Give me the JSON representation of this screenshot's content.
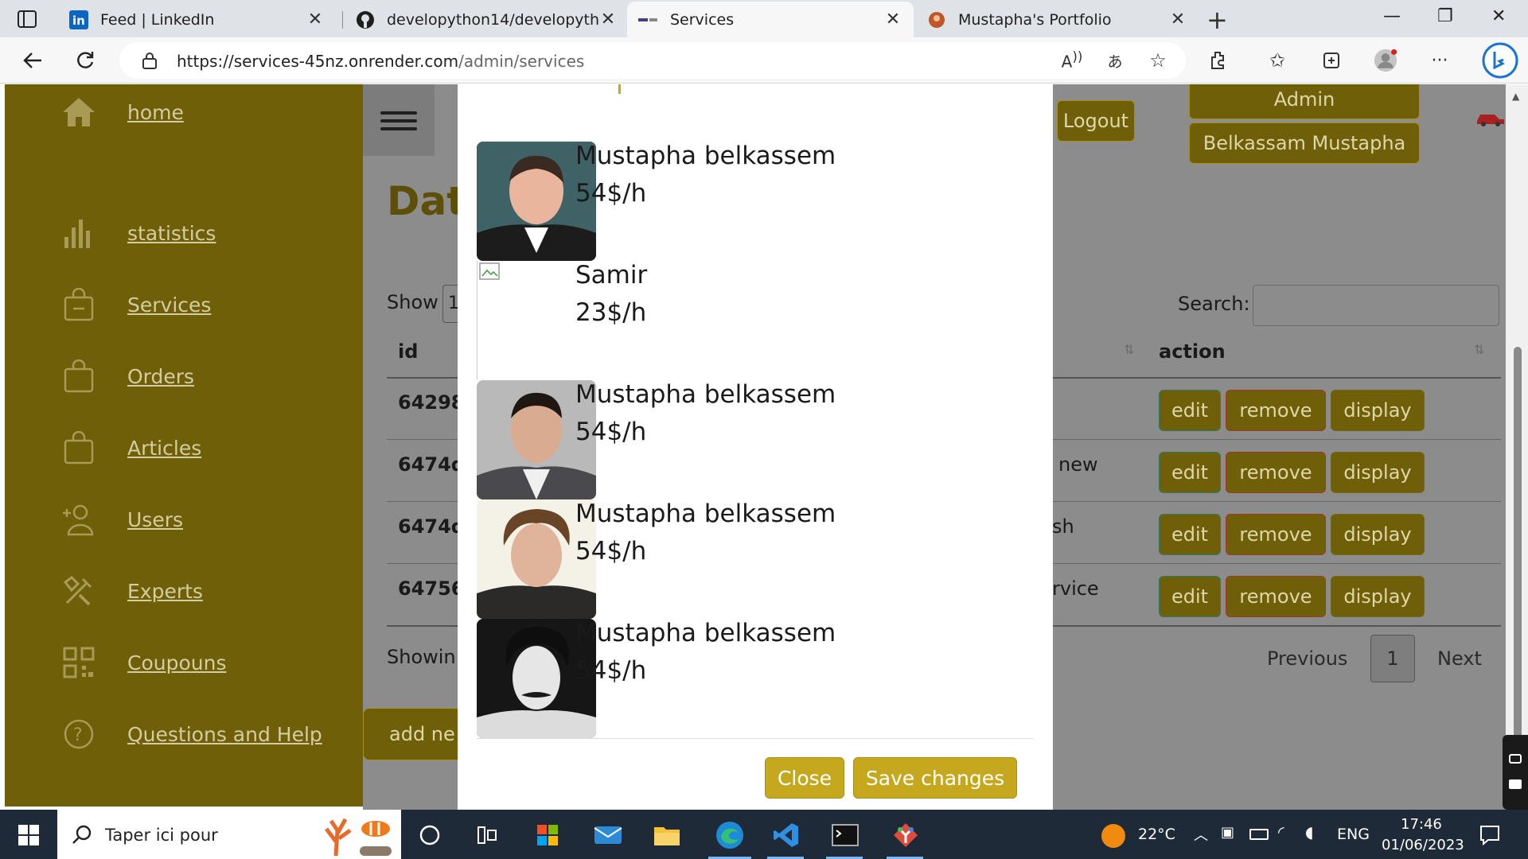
{
  "browser": {
    "tabs": [
      {
        "title": "Feed | LinkedIn",
        "icon": "linkedin-icon"
      },
      {
        "title": "developython14/developython14",
        "icon": "github-icon"
      },
      {
        "title": "Services",
        "icon": "site-favicon"
      },
      {
        "title": "Mustapha's Portfolio",
        "icon": "portfolio-favicon"
      }
    ],
    "url_host": "https://services-45nz.onrender.com",
    "url_path": "/admin/services"
  },
  "sidebar": {
    "items": [
      {
        "label": "home",
        "icon": "home-icon"
      },
      {
        "label": "statistics",
        "icon": "bar-chart-icon"
      },
      {
        "label": "Services",
        "icon": "shopping-bag-icon"
      },
      {
        "label": "Orders",
        "icon": "bag-icon"
      },
      {
        "label": "Articles",
        "icon": "bag-icon"
      },
      {
        "label": "Users",
        "icon": "user-add-icon"
      },
      {
        "label": "Experts",
        "icon": "tools-icon"
      },
      {
        "label": "Coupouns",
        "icon": "qr-code-icon"
      },
      {
        "label": "Questions and Help",
        "icon": "question-icon"
      }
    ]
  },
  "header": {
    "logout": "Logout",
    "role": "Admin",
    "user_name": "Belkassam Mustapha"
  },
  "main": {
    "title_partial": "Dat",
    "show_label": "Show",
    "show_value_partial": "1",
    "search_label": "Search:",
    "col_id": "id",
    "col_action": "action",
    "rows": [
      {
        "id": "64298",
        "desc": ""
      },
      {
        "id": "6474d",
        "desc": "new"
      },
      {
        "id": "6474d",
        "desc": "sh"
      },
      {
        "id": "64756",
        "desc": "rvice"
      }
    ],
    "btn_edit": "edit",
    "btn_remove": "remove",
    "btn_display": "display",
    "showing_partial": "Showin",
    "pagination": {
      "previous": "Previous",
      "page": "1",
      "next": "Next"
    },
    "add_button_partial": "add ne"
  },
  "modal": {
    "experts": [
      {
        "name": "Mustapha belkassem",
        "price": "54$/h",
        "photo": "portrait-suit"
      },
      {
        "name": "Samir",
        "price": "23$/h",
        "photo": "broken-image"
      },
      {
        "name": "Mustapha belkassem",
        "price": "54$/h",
        "photo": "portrait-blazer"
      },
      {
        "name": "Mustapha belkassem",
        "price": "54$/h",
        "photo": "portrait-tousled"
      },
      {
        "name": "Mustapha belkassem",
        "price": "54$/h",
        "photo": "portrait-mustache"
      }
    ],
    "close": "Close",
    "save": "Save changes"
  },
  "taskbar": {
    "search_placeholder": "Taper ici pour",
    "temperature": "22°C",
    "language": "ENG",
    "time": "17:46",
    "date": "01/06/2023"
  },
  "colors": {
    "sidebar": "#6f5f09",
    "accent": "#c5a81d",
    "overlay": "#8c8c8c"
  }
}
